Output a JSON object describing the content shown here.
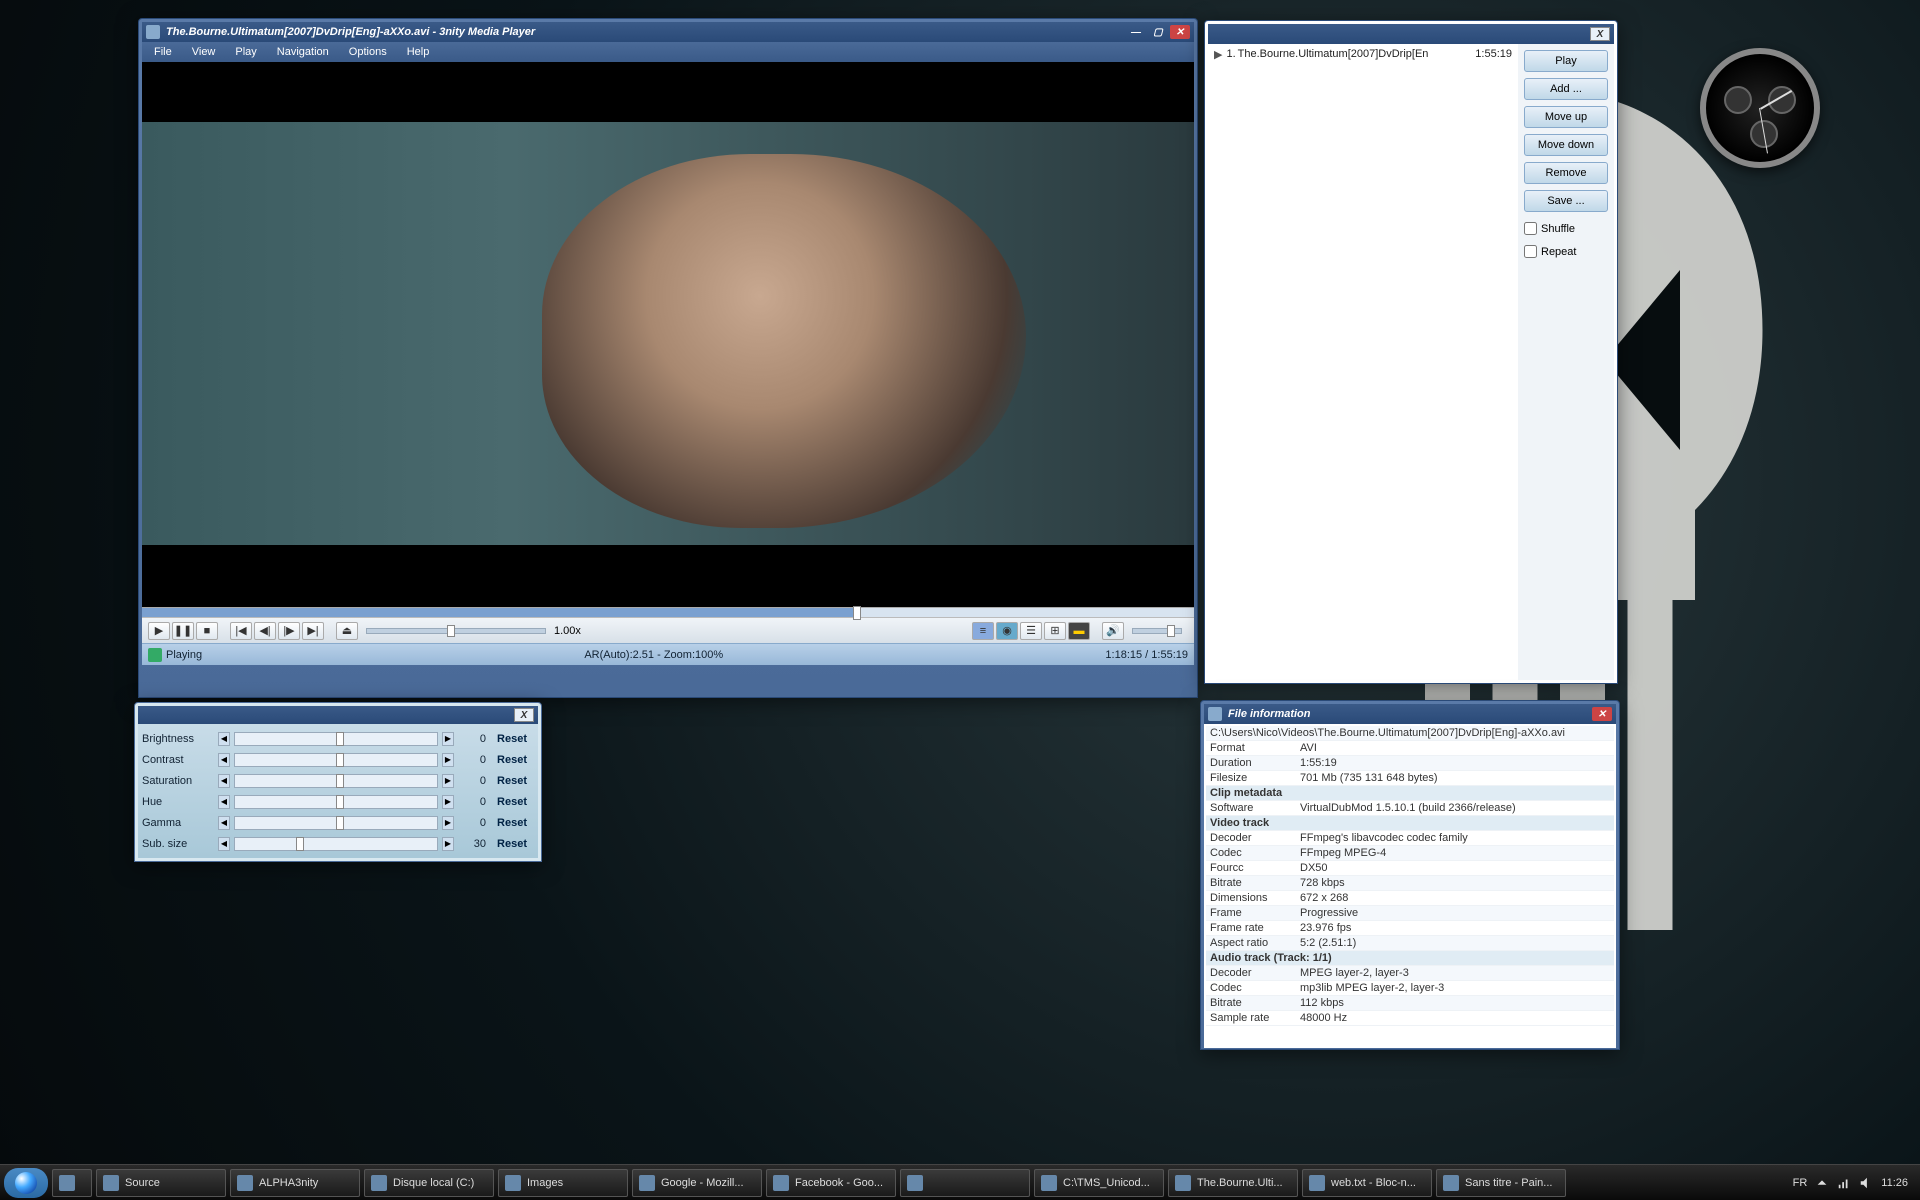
{
  "player": {
    "title": "The.Bourne.Ultimatum[2007]DvDrip[Eng]-aXXo.avi - 3nity Media Player",
    "menu": [
      "File",
      "View",
      "Play",
      "Navigation",
      "Options",
      "Help"
    ],
    "speed": "1.00x",
    "status_text": "Playing",
    "ar_zoom": "AR(Auto):2.51 - Zoom:100%",
    "time": "1:18:15 / 1:55:19",
    "seek_percent": 68
  },
  "playlist": {
    "close_label": "X",
    "entry_index": "1.",
    "entry_title": "The.Bourne.Ultimatum[2007]DvDrip[En",
    "entry_duration": "1:55:19",
    "buttons": [
      "Play",
      "Add ...",
      "Move up",
      "Move down",
      "Remove",
      "Save ..."
    ],
    "shuffle_label": "Shuffle",
    "repeat_label": "Repeat"
  },
  "adjust": {
    "close_label": "X",
    "rows": [
      {
        "label": "Brightness",
        "value": "0",
        "thumb": 50
      },
      {
        "label": "Contrast",
        "value": "0",
        "thumb": 50
      },
      {
        "label": "Saturation",
        "value": "0",
        "thumb": 50
      },
      {
        "label": "Hue",
        "value": "0",
        "thumb": 50
      },
      {
        "label": "Gamma",
        "value": "0",
        "thumb": 50
      },
      {
        "label": "Sub. size",
        "value": "30",
        "thumb": 30
      }
    ],
    "reset_label": "Reset"
  },
  "fileinfo": {
    "title": "File information",
    "path": "C:\\Users\\Nico\\Videos\\The.Bourne.Ultimatum[2007]DvDrip[Eng]-aXXo.avi",
    "rows": [
      [
        "Format",
        "AVI"
      ],
      [
        "Duration",
        "1:55:19"
      ],
      [
        "Filesize",
        "701 Mb (735 131 648 bytes)"
      ],
      [
        "__section",
        "Clip metadata"
      ],
      [
        "Software",
        "VirtualDubMod 1.5.10.1 (build 2366/release)"
      ],
      [
        "__section",
        "Video track"
      ],
      [
        "Decoder",
        "FFmpeg's libavcodec codec family"
      ],
      [
        "Codec",
        "FFmpeg MPEG-4"
      ],
      [
        "Fourcc",
        "DX50"
      ],
      [
        "Bitrate",
        "728 kbps"
      ],
      [
        "Dimensions",
        "672 x 268"
      ],
      [
        "Frame",
        "Progressive"
      ],
      [
        "Frame rate",
        "23.976 fps"
      ],
      [
        "Aspect ratio",
        "5:2  (2.51:1)"
      ],
      [
        "__section",
        "Audio track    (Track: 1/1)"
      ],
      [
        "Decoder",
        "MPEG layer-2, layer-3"
      ],
      [
        "Codec",
        "mp3lib MPEG layer-2, layer-3"
      ],
      [
        "Bitrate",
        "112 kbps"
      ],
      [
        "Sample rate",
        "48000 Hz"
      ]
    ]
  },
  "taskbar": {
    "items": [
      "Source",
      "ALPHA3nity",
      "Disque local (C:)",
      "Images",
      "Google - Mozill...",
      "Facebook - Goo...",
      "",
      "C:\\TMS_Unicod...",
      "The.Bourne.Ulti...",
      "web.txt - Bloc-n...",
      "Sans titre - Pain..."
    ],
    "lang": "FR",
    "clock": "11:26"
  }
}
